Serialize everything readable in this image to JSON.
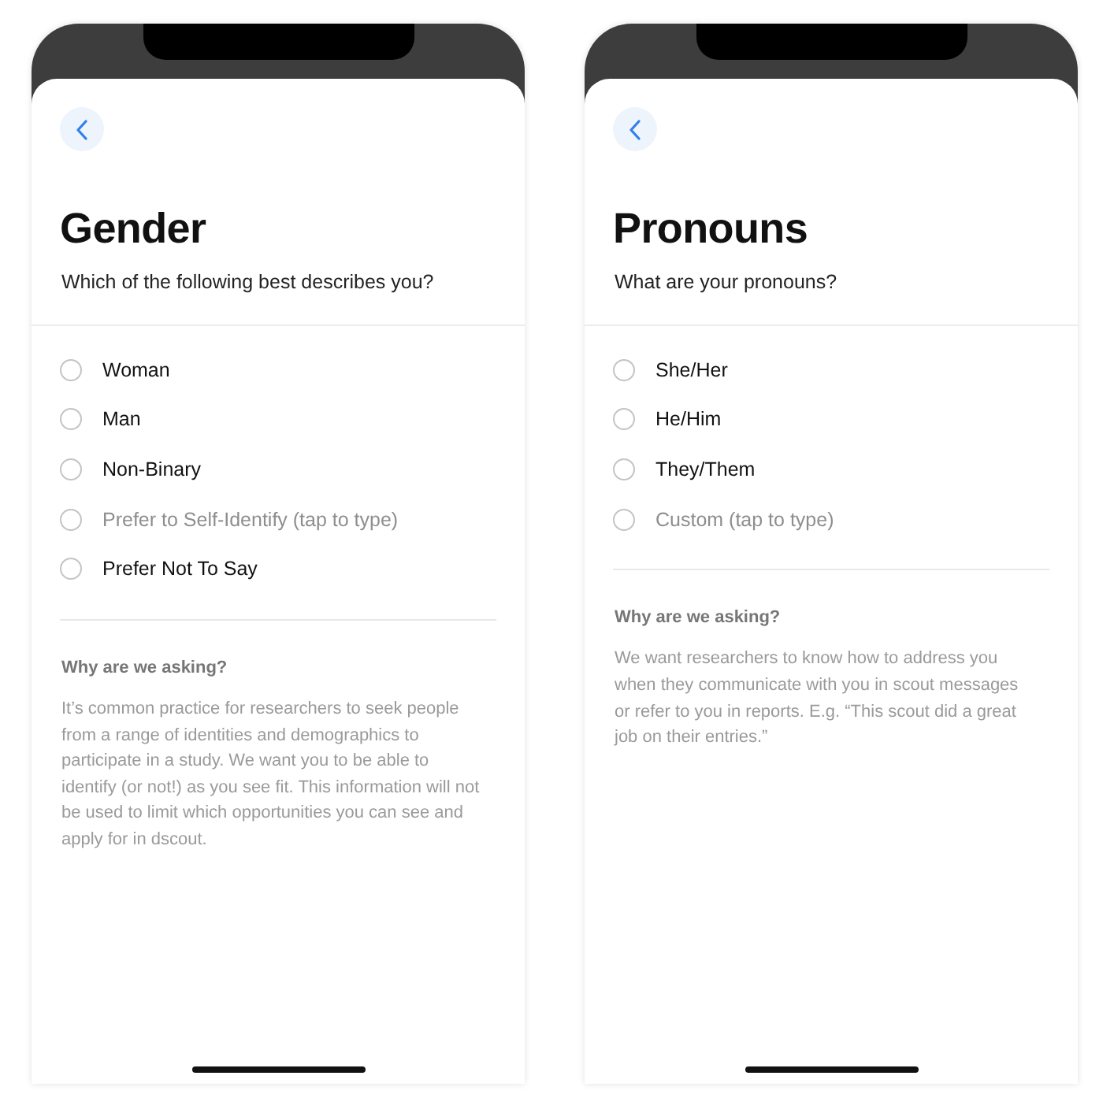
{
  "screens": [
    {
      "title": "Gender",
      "subtitle": "Which of the following best describes you?",
      "options": [
        {
          "label": "Woman",
          "kind": "choice",
          "selected": false
        },
        {
          "label": "Man",
          "kind": "choice",
          "selected": false
        },
        {
          "label": "Non-Binary",
          "kind": "choice",
          "selected": false
        },
        {
          "label": "Prefer to Self-Identify (tap to type)",
          "kind": "write-in",
          "selected": false
        },
        {
          "label": "Prefer Not To Say",
          "kind": "choice",
          "selected": false
        }
      ],
      "info": {
        "heading": "Why are we asking?",
        "text": "It’s common practice for researchers to seek people from a range of identities and demographics to participate in a study. We want you to be able to identify (or not!) as you see fit. This information will not be used to limit which opportunities you can see and apply for in dscout."
      }
    },
    {
      "title": "Pronouns",
      "subtitle": "What are your pronouns?",
      "options": [
        {
          "label": "She/Her",
          "kind": "choice",
          "selected": false
        },
        {
          "label": "He/Him",
          "kind": "choice",
          "selected": false
        },
        {
          "label": "They/Them",
          "kind": "choice",
          "selected": false
        },
        {
          "label": "Custom (tap to type)",
          "kind": "write-in",
          "selected": false
        }
      ],
      "info": {
        "heading": "Why are we asking?",
        "text": "We want researchers to know how to address you when they communicate with you in scout messages or refer to you in reports. E.g. “This scout did a great job on their entries.”"
      }
    }
  ]
}
